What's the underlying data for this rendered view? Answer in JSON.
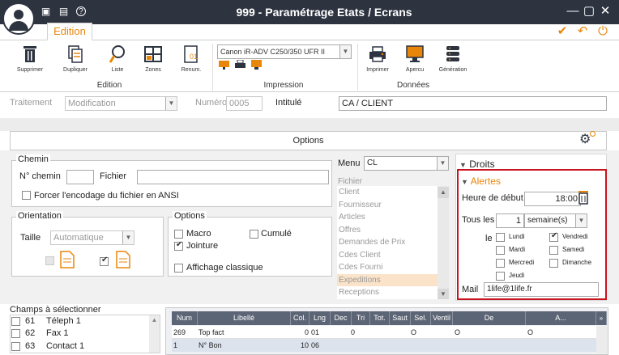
{
  "window": {
    "title": "999 - Paramétrage Etats / Ecrans"
  },
  "ribbon": {
    "tab": "Edition",
    "groups": {
      "edition": "Edition",
      "impression": "Impression",
      "donnees": "Données"
    },
    "buttons": {
      "supprimer": "Supprimer",
      "dupliquer": "Dupliquer",
      "liste": "Liste",
      "zones": "Zones",
      "renum": "Renum.",
      "imprimer": "Imprimer",
      "apercu": "Apercu",
      "generation": "Génération"
    },
    "printer": "Canon iR-ADV C250/350 UFR II"
  },
  "form": {
    "traitement_label": "Traitement",
    "traitement_value": "Modification",
    "numero_label": "Numéro",
    "numero_value": "0005",
    "intitule_label": "Intitulé",
    "intitule_value": "CA / CLIENT"
  },
  "options_bar": {
    "label": "Options"
  },
  "chemin": {
    "title": "Chemin",
    "num_label": "N° chemin",
    "num_value": "",
    "fichier_label": "Fichier",
    "fichier_value": "",
    "force_label": "Forcer l'encodage du fichier en ANSI"
  },
  "orientation": {
    "title": "Orientation",
    "taille_label": "Taille",
    "taille_value": "Automatique"
  },
  "options": {
    "title": "Options",
    "macro": "Macro",
    "cumule": "Cumulé",
    "jointure": "Jointure",
    "affichage": "Affichage classique"
  },
  "menu": {
    "label": "Menu",
    "value": "CL",
    "fichier_label": "Fichier",
    "items": [
      "Client",
      "Fournisseur",
      "Articles",
      "Offres",
      "Demandes de Prix",
      "Cdes Client",
      "Cdes Fourni",
      "Expeditions",
      "Receptions"
    ],
    "selected": "Expeditions"
  },
  "droits": {
    "title": "Droits"
  },
  "alertes": {
    "title": "Alertes",
    "heure_label": "Heure de début",
    "heure_value": "18:00",
    "tous_les_label": "Tous les",
    "tous_les_value": "1",
    "unit_value": "semaine(s)",
    "le_label": "le",
    "days": {
      "lundi": "Lundi",
      "mardi": "Mardi",
      "mercredi": "Mercredi",
      "jeudi": "Jeudi",
      "vendredi": "Vendredi",
      "samedi": "Samedi",
      "dimanche": "Dimanche"
    },
    "mail_label": "Mail",
    "mail_value": "1life@1life.fr"
  },
  "champs": {
    "title": "Champs  à  sélectionner",
    "items": [
      {
        "num": "61",
        "label": "Téleph 1"
      },
      {
        "num": "62",
        "label": "Fax 1"
      },
      {
        "num": "63",
        "label": "Contact 1"
      }
    ]
  },
  "table": {
    "columns": [
      "Num",
      "Libellé",
      "Col.",
      "Lng",
      "Dec",
      "Tri",
      "Tot.",
      "Saut",
      "Sel.",
      "Ventil",
      "De",
      "A..."
    ],
    "rows": [
      [
        "269",
        "Top fact",
        "0",
        "01",
        "0",
        "",
        "",
        "",
        "O",
        "",
        "O",
        "O"
      ],
      [
        "1",
        "N° Bon",
        "10",
        "06",
        "",
        "",
        "",
        "",
        "",
        "",
        "",
        ""
      ]
    ]
  }
}
